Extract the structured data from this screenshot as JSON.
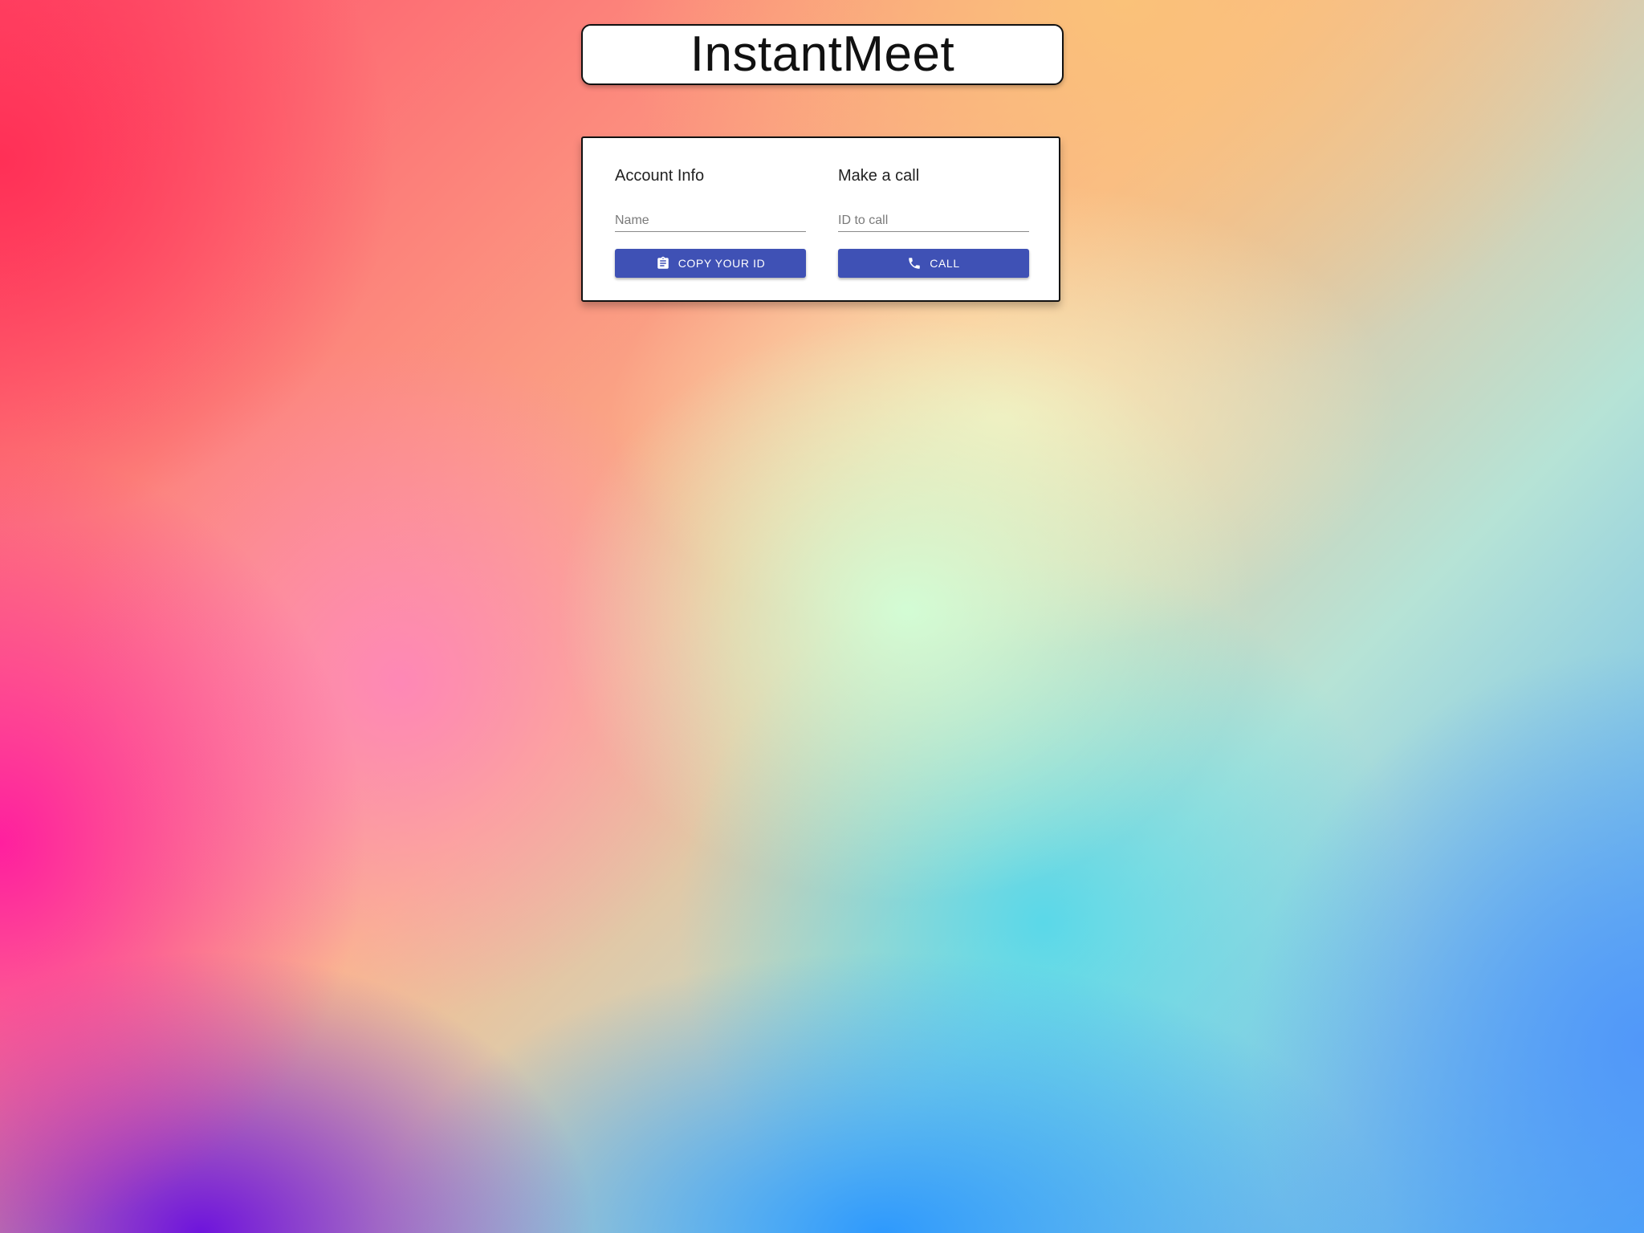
{
  "app": {
    "title": "InstantMeet"
  },
  "account_info": {
    "heading": "Account Info",
    "name_field": {
      "value": "",
      "placeholder": "Name"
    },
    "copy_button": {
      "label": "COPY YOUR ID",
      "icon": "clipboard-icon"
    }
  },
  "make_call": {
    "heading": "Make a call",
    "id_field": {
      "value": "",
      "placeholder": "ID to call"
    },
    "call_button": {
      "label": "CALL",
      "icon": "phone-icon"
    }
  },
  "colors": {
    "button": "#3f51b5",
    "button_text": "#ffffff",
    "card": "#ffffff",
    "border": "#111111"
  }
}
